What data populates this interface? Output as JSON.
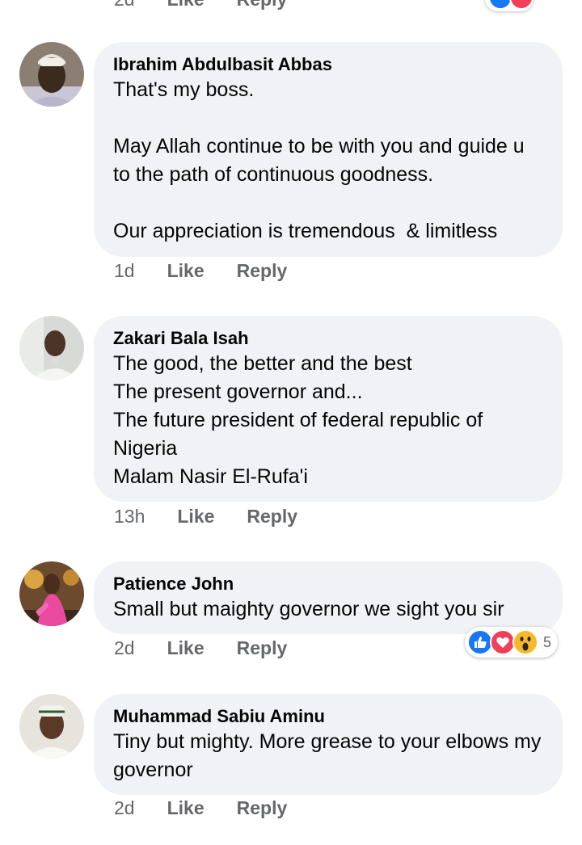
{
  "top_partial": {
    "time": "2d",
    "like_label": "Like",
    "reply_label": "Reply"
  },
  "comments": [
    {
      "author": "Ibrahim Abdulbasit Abbas",
      "text": "That's my boss.\n\nMay Allah continue to be with you and guide u to the path of continuous goodness.\n\nOur appreciation is tremendous  & limitless",
      "time": "1d",
      "like_label": "Like",
      "reply_label": "Reply"
    },
    {
      "author": "Zakari Bala Isah",
      "text": "The good, the better and the best\nThe present governor and...\nThe future president of federal republic of Nigeria\nMalam Nasir El-Rufa'i",
      "time": "13h",
      "like_label": "Like",
      "reply_label": "Reply"
    },
    {
      "author": "Patience John",
      "text": "Small but maighty governor we sight you sir",
      "time": "2d",
      "like_label": "Like",
      "reply_label": "Reply",
      "reactions": {
        "icons": [
          "like-icon",
          "love-icon",
          "wow-icon"
        ],
        "count": "5"
      }
    },
    {
      "author": "Muhammad Sabiu Aminu",
      "text": "Tiny but mighty. More grease to your elbows my governor",
      "time": "2d",
      "like_label": "Like",
      "reply_label": "Reply"
    }
  ],
  "colors": {
    "bubble": "#f0f2f5",
    "meta": "#65676b",
    "like": "#1877f2",
    "love": "#f33e58",
    "wow": "#f7b928"
  }
}
